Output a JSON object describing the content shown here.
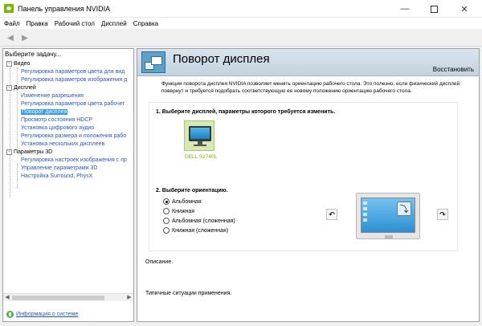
{
  "window": {
    "title": "Панель управления NVIDIA",
    "minimize": "—",
    "close": "✕"
  },
  "menu": [
    "Файл",
    "Правка",
    "Рабочий стол",
    "Дисплей",
    "Справка"
  ],
  "toolbar": {
    "back": "◀",
    "forward": "▶"
  },
  "sidebar": {
    "header": "Выберите задачу...",
    "categories": [
      {
        "label": "Видео",
        "expander": "−",
        "items": [
          {
            "label": "Регулировка параметров цвета для вид",
            "selected": false
          },
          {
            "label": "Регулировка параметров изображения д",
            "selected": false
          }
        ]
      },
      {
        "label": "Дисплей",
        "expander": "−",
        "items": [
          {
            "label": "Изменение разрешения",
            "selected": false
          },
          {
            "label": "Регулировка параметров цвета рабочег",
            "selected": false
          },
          {
            "label": "Поворот дисплея",
            "selected": true
          },
          {
            "label": "Просмотр состояния HDCP",
            "selected": false
          },
          {
            "label": "Установка цифрового аудио",
            "selected": false
          },
          {
            "label": "Регулировка размера и положения рабо",
            "selected": false
          },
          {
            "label": "Установка нескольких дисплеев",
            "selected": false
          }
        ]
      },
      {
        "label": "Параметры 3D",
        "expander": "−",
        "items": [
          {
            "label": "Регулировка настроек изображения с пр",
            "selected": false
          },
          {
            "label": "Управление параметрами 3D",
            "selected": false
          },
          {
            "label": "Настройка Surround, PhysX",
            "selected": false
          }
        ]
      }
    ],
    "scroll_left": "◀",
    "scroll_right": "▶",
    "system_info": "Информация о системе"
  },
  "main": {
    "title": "Поворот дисплея",
    "restore": "Восстановить",
    "description": "Функция поворота дисплея NVIDIA позволяет менять ориентацию рабочего стола. Это полезно, если физический дисплей повернут и требуется подобрать соответствующую ее новому положению ориентацию рабочего стола.",
    "step1": "1. Выберите дисплей, параметры которого требуется изменить.",
    "display_name": "DELL S2740L",
    "step2": "2. Выберите ориентацию.",
    "orientations": [
      {
        "label": "Альбомная",
        "checked": true
      },
      {
        "label": "Книжная",
        "checked": false
      },
      {
        "label": "Альбомная (сложенная)",
        "checked": false
      },
      {
        "label": "Книжная (сложенная)",
        "checked": false
      }
    ],
    "rotate_left": "↶",
    "rotate_right": "↷",
    "preview_rotate": "⤵",
    "description_label": "Описание.",
    "usage_label": "Типичные ситуации применения."
  }
}
